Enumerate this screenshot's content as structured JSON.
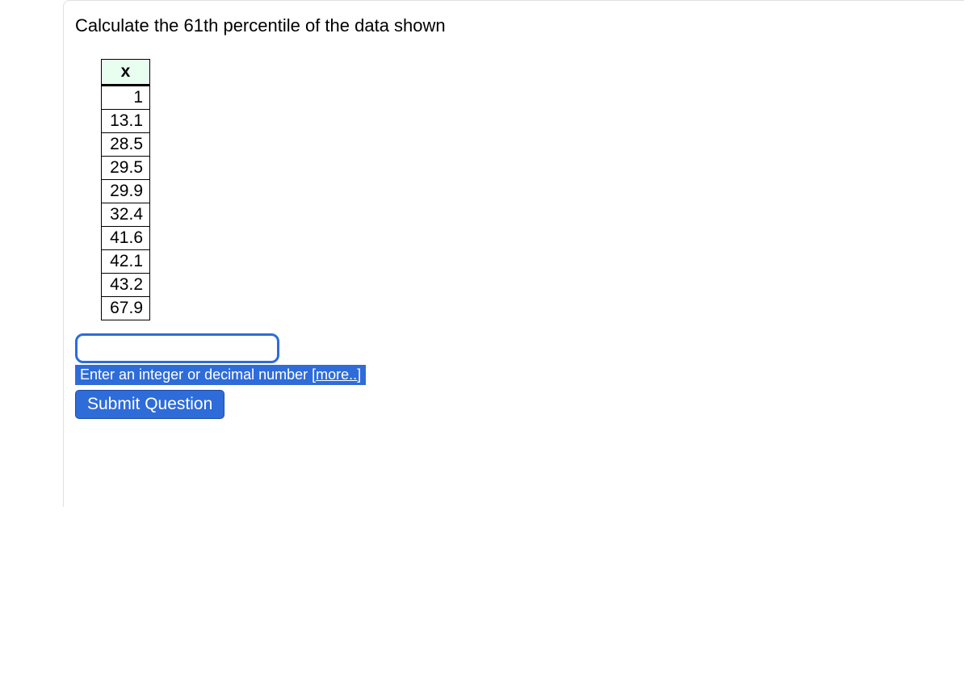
{
  "question": {
    "prompt": "Calculate the 61th percentile of the data shown"
  },
  "table": {
    "header": "x",
    "rows": [
      "1",
      "13.1",
      "28.5",
      "29.5",
      "29.9",
      "32.4",
      "41.6",
      "42.1",
      "43.2",
      "67.9"
    ]
  },
  "input": {
    "value": "",
    "hint_prefix": "Enter an integer or decimal number ",
    "hint_more": "[more..]"
  },
  "buttons": {
    "submit": "Submit Question"
  }
}
